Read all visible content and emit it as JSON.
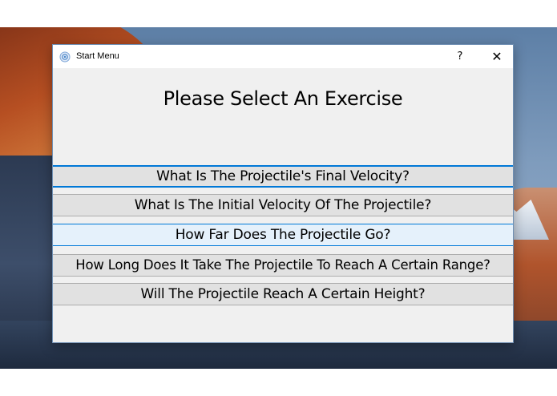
{
  "window": {
    "title": "Start Menu",
    "help_label": "?",
    "close_label": "✕"
  },
  "main": {
    "heading": "Please Select An Exercise",
    "options": [
      {
        "label": "What Is The Projectile's Final Velocity?",
        "state": "focused"
      },
      {
        "label": "What Is The Initial Velocity Of The Projectile?",
        "state": "normal"
      },
      {
        "label": "How Far Does The Projectile Go?",
        "state": "hover"
      },
      {
        "label": "How Long Does It Take The Projectile To Reach A Certain Range?",
        "state": "normal"
      },
      {
        "label": "Will The Projectile Reach A Certain Height?",
        "state": "normal"
      }
    ]
  },
  "colors": {
    "focus_accent": "#0078d7",
    "button_face": "#e1e1e1",
    "button_hover": "#e5f1fb",
    "window_bg": "#f0f0f0"
  },
  "icons": {
    "app": "app-icon",
    "close": "close-icon"
  }
}
